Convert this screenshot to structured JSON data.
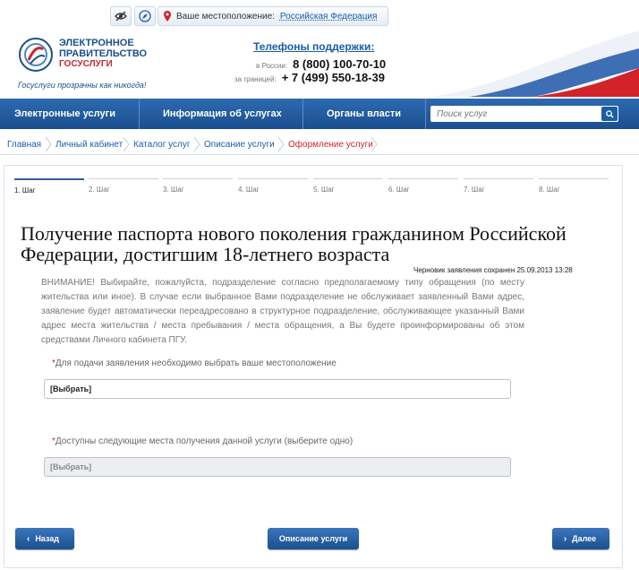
{
  "topbar": {
    "location_label": "Ваше местоположение:",
    "location_value": "Российская Федерация"
  },
  "header": {
    "logo_line1": "ЭЛЕКТРОННОЕ",
    "logo_line2": "ПРАВИТЕЛЬСТВО",
    "logo_line3": "ГОСУСЛУГИ",
    "slogan": "Госуслуги прозрачны как никогда!",
    "phones_title": "Телефоны поддержки:",
    "phone_ru_label": "в России:",
    "phone_ru": "8 (800) 100-70-10",
    "phone_abroad_label": "за границей:",
    "phone_abroad": "+ 7 (499) 550-18-39"
  },
  "nav": {
    "items": [
      "Электронные услуги",
      "Информация об услугах",
      "Органы власти"
    ],
    "search_placeholder": "Поиск услуг"
  },
  "breadcrumbs": [
    "Главная",
    "Личный кабинет",
    "Каталог услуг",
    "Описание услуги",
    "Оформление услуги"
  ],
  "steps": [
    "1. Шаг",
    "2. Шаг",
    "3. Шаг",
    "4. Шаг",
    "5. Шаг",
    "6. Шаг",
    "7. Шаг",
    "8. Шаг"
  ],
  "main": {
    "title": "Получение паспорта нового поколения гражданином Российской Федерации, достигшим 18-летнего возраста",
    "draft_saved": "Черновик заявления сохранен 25.09.2013 13:28",
    "warning": "ВНИМАНИЕ! Выбирайте, пожалуйста, подразделение согласно предполагаемому типу обращения (по месту жительства или иное). В случае если выбранное Вами подразделение не обслуживает заявленный Вами адрес, заявление будет автоматически переадресовано в структурное подразделение, обслуживающее указанный Вами адрес места жительства / места пребывания / места обращения, а Вы будете проинформированы об этом средствами Личного кабинета ПГУ.",
    "field1_label": "Для подачи заявления необходимо выбрать ваше местоположение",
    "field1_value": "[Выбрать]",
    "field2_label": "Доступны следующие места получения данной услуги (выберите одно)",
    "field2_value": "[Выбрать]",
    "asterisk": "*"
  },
  "buttons": {
    "back": "Назад",
    "description": "Описание услуги",
    "next": "Далее"
  },
  "colors": {
    "nav_blue": "#1a4f8f",
    "link_blue": "#1a5ea8",
    "active_red": "#d2232a"
  }
}
